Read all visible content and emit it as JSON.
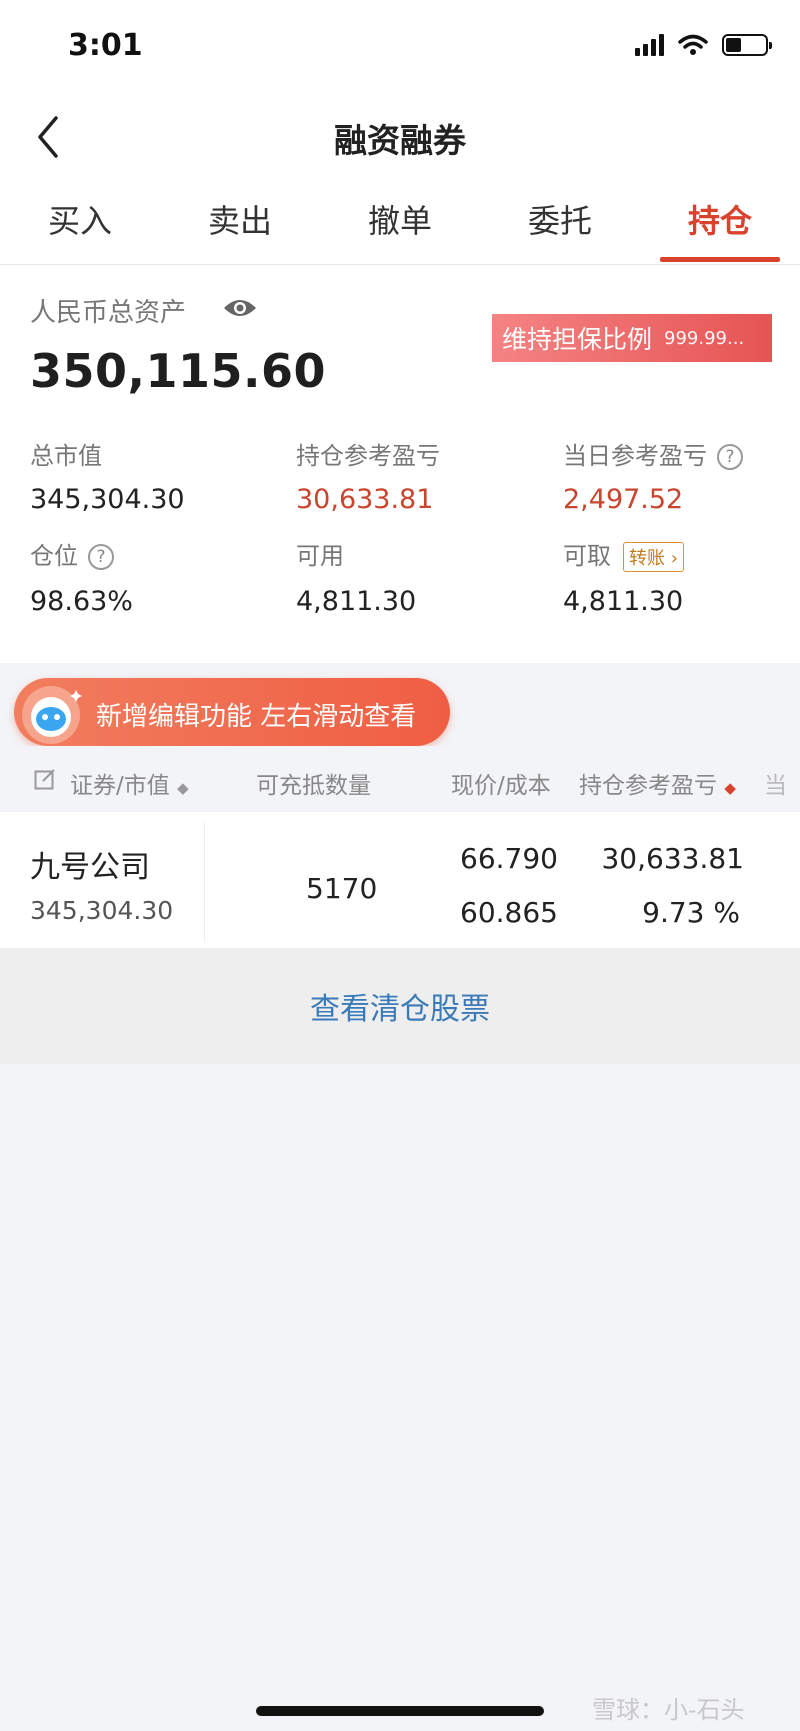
{
  "status_bar": {
    "time": "3:01"
  },
  "nav": {
    "title": "融资融券"
  },
  "tabs": [
    {
      "label": "买入",
      "active": false
    },
    {
      "label": "卖出",
      "active": false
    },
    {
      "label": "撤单",
      "active": false
    },
    {
      "label": "委托",
      "active": false
    },
    {
      "label": "持仓",
      "active": true
    }
  ],
  "assets": {
    "total_label": "人民币总资产",
    "total_value": "350,115.60",
    "ratio_label": "维持担保比例",
    "ratio_value": "999.99...",
    "market_value_label": "总市值",
    "market_value": "345,304.30",
    "holding_pl_label": "持仓参考盈亏",
    "holding_pl": "30,633.81",
    "daily_pl_label": "当日参考盈亏",
    "daily_pl": "2,497.52",
    "position_label": "仓位",
    "position": "98.63%",
    "available_label": "可用",
    "available": "4,811.30",
    "withdrawable_label": "可取",
    "withdrawable": "4,811.30",
    "transfer_label": "转账",
    "help_glyph": "?"
  },
  "promo": {
    "text": "新增编辑功能 左右滑动查看"
  },
  "table": {
    "headers": {
      "security": "证券/市值",
      "collateral_qty": "可充抵数量",
      "price_cost": "现价/成本",
      "holding_pl": "持仓参考盈亏",
      "overflow": "当"
    },
    "rows": [
      {
        "name": "九号公司",
        "market_value": "345,304.30",
        "collateral_qty": "5170",
        "price": "66.790",
        "cost": "60.865",
        "pl": "30,633.81",
        "pl_pct": "9.73 %"
      }
    ]
  },
  "clear_link": "查看清仓股票",
  "watermark": "雪球：小-石头",
  "colors": {
    "accent": "#d9432e",
    "link": "#3a7ab8",
    "gain": "#c8452e"
  }
}
